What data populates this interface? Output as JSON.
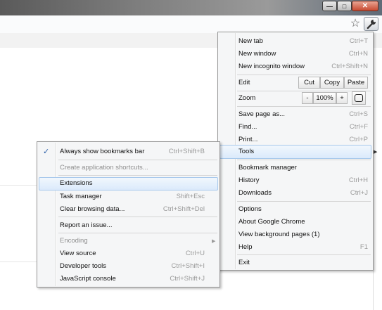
{
  "window": {
    "minimize_glyph": "—",
    "maximize_glyph": "□",
    "close_glyph": "✕"
  },
  "toolbar": {
    "star_glyph": "☆",
    "wrench_glyph": "🔧"
  },
  "main_menu": {
    "new_tab": {
      "label": "New tab",
      "shortcut": "Ctrl+T"
    },
    "new_window": {
      "label": "New window",
      "shortcut": "Ctrl+N"
    },
    "new_incognito": {
      "label": "New incognito window",
      "shortcut": "Ctrl+Shift+N"
    },
    "edit": {
      "label": "Edit",
      "cut": "Cut",
      "copy": "Copy",
      "paste": "Paste"
    },
    "zoom": {
      "label": "Zoom",
      "minus": "-",
      "value": "100%",
      "plus": "+"
    },
    "save_page": {
      "label": "Save page as...",
      "shortcut": "Ctrl+S"
    },
    "find": {
      "label": "Find...",
      "shortcut": "Ctrl+F"
    },
    "print": {
      "label": "Print...",
      "shortcut": "Ctrl+P"
    },
    "tools": {
      "label": "Tools",
      "arrow": "▶"
    },
    "bookmark_manager": {
      "label": "Bookmark manager"
    },
    "history": {
      "label": "History",
      "shortcut": "Ctrl+H"
    },
    "downloads": {
      "label": "Downloads",
      "shortcut": "Ctrl+J"
    },
    "options": {
      "label": "Options"
    },
    "about": {
      "label": "About Google Chrome"
    },
    "background_pages": {
      "label": "View background pages (1)"
    },
    "help": {
      "label": "Help",
      "shortcut": "F1"
    },
    "exit": {
      "label": "Exit"
    }
  },
  "tools_menu": {
    "bookmarks_bar": {
      "label": "Always show bookmarks bar",
      "shortcut": "Ctrl+Shift+B",
      "checked": true,
      "check_glyph": "✓"
    },
    "app_shortcuts": {
      "label": "Create application shortcuts..."
    },
    "extensions": {
      "label": "Extensions"
    },
    "task_manager": {
      "label": "Task manager",
      "shortcut": "Shift+Esc"
    },
    "clear_data": {
      "label": "Clear browsing data...",
      "shortcut": "Ctrl+Shift+Del"
    },
    "report_issue": {
      "label": "Report an issue..."
    },
    "encoding": {
      "label": "Encoding",
      "arrow": "▶"
    },
    "view_source": {
      "label": "View source",
      "shortcut": "Ctrl+U"
    },
    "developer_tools": {
      "label": "Developer tools",
      "shortcut": "Ctrl+Shift+I"
    },
    "javascript_console": {
      "label": "JavaScript console",
      "shortcut": "Ctrl+Shift+J"
    }
  }
}
